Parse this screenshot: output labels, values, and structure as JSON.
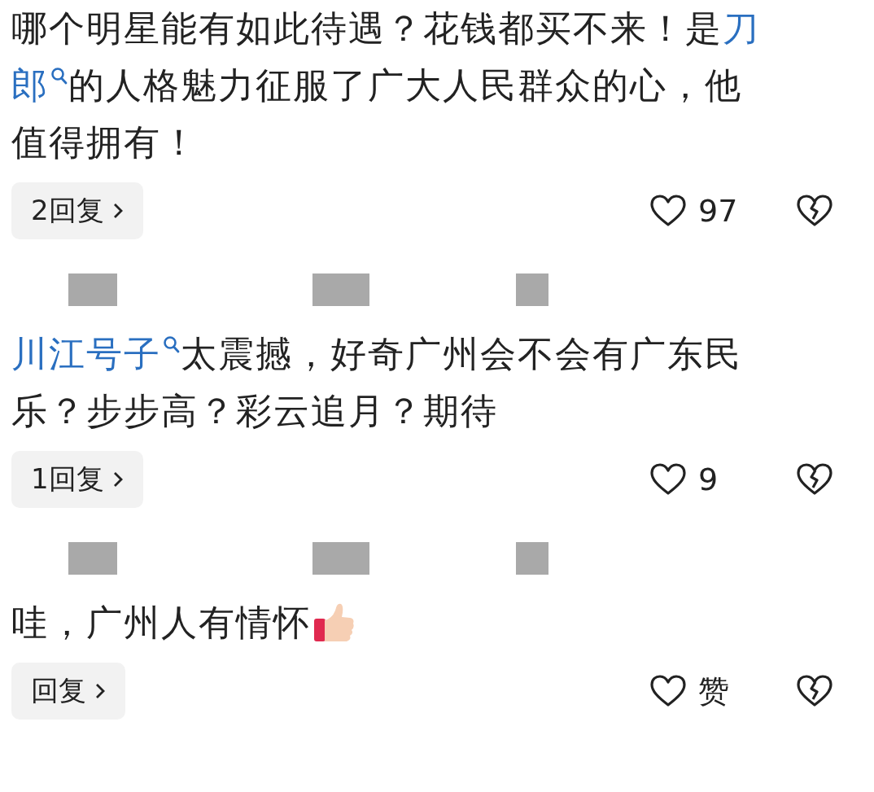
{
  "comments": [
    {
      "lines": [
        [
          {
            "kind": "text",
            "text": "哪个明星能有如此待遇？花钱都买不来！是"
          },
          {
            "kind": "link",
            "text": "刀"
          }
        ],
        [
          {
            "kind": "link",
            "text": "郎",
            "search": true
          },
          {
            "kind": "text",
            "text": " 的人格魅力征服了广大人民群众的心，他"
          }
        ],
        [
          {
            "kind": "text",
            "text": "值得拥有！"
          }
        ]
      ],
      "replies": "2回复",
      "likes": "97"
    },
    {
      "header_redacted": true,
      "lines": [
        [
          {
            "kind": "link",
            "text": "川江号子",
            "search": true
          },
          {
            "kind": "text",
            "text": " 太震撼，好奇广州会不会有广东民"
          }
        ],
        [
          {
            "kind": "text",
            "text": "乐？步步高？彩云追月？期待"
          }
        ]
      ],
      "replies": "1回复",
      "likes": "9"
    },
    {
      "header_redacted": true,
      "lines": [
        [
          {
            "kind": "text",
            "text": "哇，广州人有情怀"
          },
          {
            "kind": "emoji"
          }
        ]
      ],
      "replies": "回复",
      "likes": "赞"
    }
  ]
}
